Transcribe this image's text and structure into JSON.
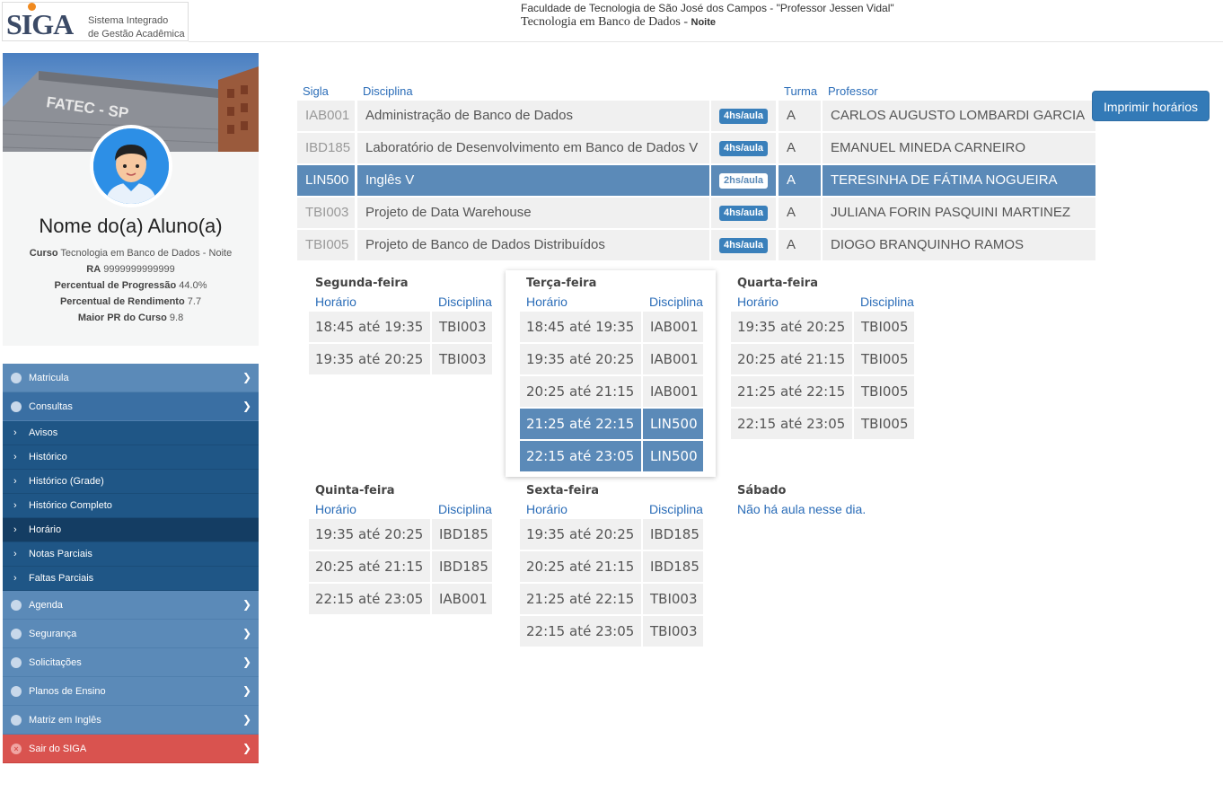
{
  "header": {
    "logo_main": "SIGA",
    "logo_line1": "Sistema Integrado",
    "logo_line2": "de Gestão Acadêmica",
    "faculty": "Faculdade de Tecnologia de São José dos Campos - \"Professor Jessen Vidal\"",
    "course": "Tecnologia em Banco de Dados -",
    "shift": "Noite"
  },
  "profile": {
    "banner_text": "FATEC - SP",
    "name": "Nome do(a) Aluno(a)",
    "course_label": "Curso",
    "course_value": "Tecnologia em Banco de Dados - Noite",
    "ra_label": "RA",
    "ra_value": "9999999999999",
    "progress_label": "Percentual de Progressão",
    "progress_value": "44.0%",
    "yield_label": "Percentual de Rendimento",
    "yield_value": "7.7",
    "maxpr_label": "Maior PR do Curso",
    "maxpr_value": "9.8"
  },
  "menu": {
    "matricula": "Matricula",
    "consultas": "Consultas",
    "sub": [
      "Avisos",
      "Histórico",
      "Histórico (Grade)",
      "Histórico Completo",
      "Horário",
      "Notas Parciais",
      "Faltas Parciais"
    ],
    "agenda": "Agenda",
    "seguranca": "Segurança",
    "solicitacoes": "Solicitações",
    "planos": "Planos de Ensino",
    "matriz": "Matriz em Inglês",
    "sair": "Sair do SIGA"
  },
  "table": {
    "headers": {
      "sigla": "Sigla",
      "disciplina": "Disciplina",
      "turma": "Turma",
      "professor": "Professor"
    },
    "rows": [
      {
        "sigla": "IAB001",
        "disciplina": "Administração de Banco de Dados",
        "carga": "4hs/aula",
        "turma": "A",
        "professor": "CARLOS AUGUSTO LOMBARDI GARCIA"
      },
      {
        "sigla": "IBD185",
        "disciplina": "Laboratório de Desenvolvimento em Banco de Dados V",
        "carga": "4hs/aula",
        "turma": "A",
        "professor": "EMANUEL MINEDA CARNEIRO"
      },
      {
        "sigla": "LIN500",
        "disciplina": "Inglês V",
        "carga": "2hs/aula",
        "turma": "A",
        "professor": "TERESINHA DE FÁTIMA NOGUEIRA"
      },
      {
        "sigla": "TBI003",
        "disciplina": "Projeto de Data Warehouse",
        "carga": "4hs/aula",
        "turma": "A",
        "professor": "JULIANA FORIN PASQUINI MARTINEZ"
      },
      {
        "sigla": "TBI005",
        "disciplina": "Projeto de Banco de Dados Distribuídos",
        "carga": "4hs/aula",
        "turma": "A",
        "professor": "DIOGO BRANQUINHO RAMOS"
      }
    ]
  },
  "print_button": "Imprimir horários",
  "schedule": {
    "col_time": "Horário",
    "col_subject": "Disciplina",
    "no_class": "Não há aula nesse dia.",
    "days": [
      {
        "name": "Segunda-feira",
        "slots": [
          {
            "time": "18:45 até 19:35",
            "code": "TBI003"
          },
          {
            "time": "19:35 até 20:25",
            "code": "TBI003"
          }
        ]
      },
      {
        "name": "Terça-feira",
        "slots": [
          {
            "time": "18:45 até 19:35",
            "code": "IAB001"
          },
          {
            "time": "19:35 até 20:25",
            "code": "IAB001"
          },
          {
            "time": "20:25 até 21:15",
            "code": "IAB001"
          },
          {
            "time": "21:25 até 22:15",
            "code": "LIN500"
          },
          {
            "time": "22:15 até 23:05",
            "code": "LIN500"
          }
        ]
      },
      {
        "name": "Quarta-feira",
        "slots": [
          {
            "time": "19:35 até 20:25",
            "code": "TBI005"
          },
          {
            "time": "20:25 até 21:15",
            "code": "TBI005"
          },
          {
            "time": "21:25 até 22:15",
            "code": "TBI005"
          },
          {
            "time": "22:15 até 23:05",
            "code": "TBI005"
          }
        ]
      },
      {
        "name": "Quinta-feira",
        "slots": [
          {
            "time": "19:35 até 20:25",
            "code": "IBD185"
          },
          {
            "time": "20:25 até 21:15",
            "code": "IBD185"
          },
          {
            "time": "22:15 até 23:05",
            "code": "IAB001"
          }
        ]
      },
      {
        "name": "Sexta-feira",
        "slots": [
          {
            "time": "19:35 até 20:25",
            "code": "IBD185"
          },
          {
            "time": "20:25 até 21:15",
            "code": "IBD185"
          },
          {
            "time": "21:25 até 22:15",
            "code": "TBI003"
          },
          {
            "time": "22:15 até 23:05",
            "code": "TBI003"
          }
        ]
      },
      {
        "name": "Sábado",
        "slots": []
      }
    ]
  }
}
